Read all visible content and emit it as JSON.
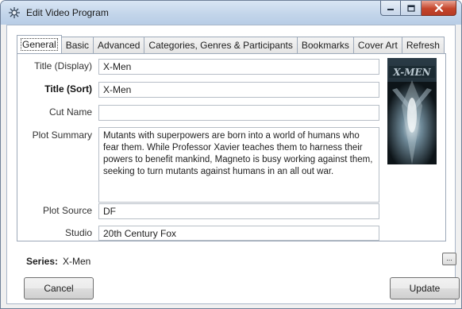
{
  "window": {
    "title": "Edit Video Program",
    "icon": "gear-flower-icon",
    "caption_buttons": [
      "minimize-icon",
      "maximize-icon",
      "close-icon"
    ]
  },
  "tabs": [
    {
      "label": "General",
      "active": true
    },
    {
      "label": "Basic",
      "active": false
    },
    {
      "label": "Advanced",
      "active": false
    },
    {
      "label": "Categories, Genres & Participants",
      "active": false
    },
    {
      "label": "Bookmarks",
      "active": false
    },
    {
      "label": "Cover Art",
      "active": false
    },
    {
      "label": "Refresh",
      "active": false
    }
  ],
  "general": {
    "title_display_label": "Title (Display)",
    "title_display_value": "X-Men",
    "title_sort_label": "Title (Sort)",
    "title_sort_value": "X-Men",
    "cut_name_label": "Cut Name",
    "cut_name_value": "",
    "plot_summary_label": "Plot Summary",
    "plot_summary_value": "Mutants with superpowers are born into a world of humans who fear them. While Professor Xavier teaches them to harness their powers to benefit mankind, Magneto is busy working against them, seeking to turn mutants against humans in an all out war.",
    "plot_source_label": "Plot Source",
    "plot_source_value": "DF",
    "studio_label": "Studio",
    "studio_value": "20th Century Fox",
    "cover_art_text": "X-MEN"
  },
  "series": {
    "label": "Series:",
    "value": "X-Men",
    "browse_label": "..."
  },
  "buttons": {
    "cancel": "Cancel",
    "update": "Update"
  },
  "colors": {
    "titlebar": "#c3d5ea",
    "close_button": "#c5452b",
    "window_background": "#f0f0f0"
  }
}
